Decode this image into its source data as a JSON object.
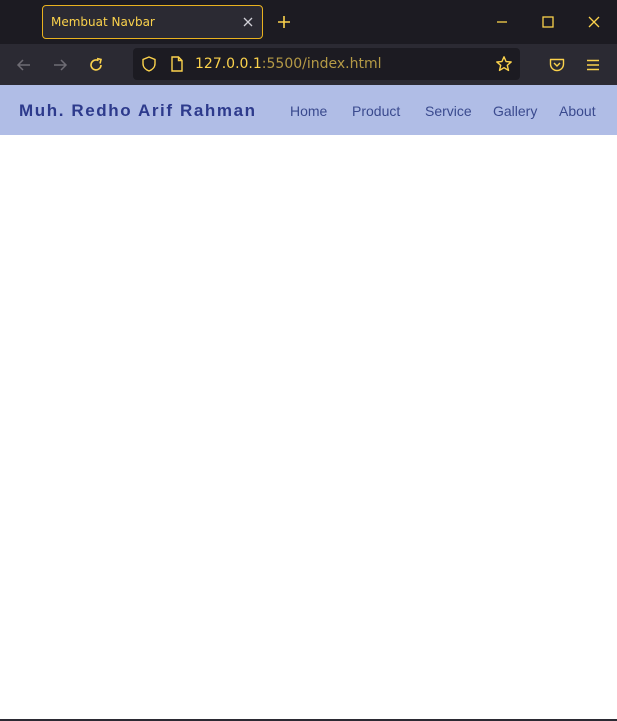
{
  "browser": {
    "tab": {
      "title": "Membuat Navbar"
    },
    "url": {
      "host": "127.0.0.1",
      "path": ":5500/index.html"
    },
    "icons": {
      "back": "back-arrow-icon",
      "forward": "forward-arrow-icon",
      "reload": "reload-icon",
      "shield": "shield-icon",
      "page": "page-icon",
      "bookmark": "star-icon",
      "pocket": "pocket-icon",
      "menu": "hamburger-icon"
    }
  },
  "site": {
    "brand": "Muh. Redho Arif Rahman",
    "nav": {
      "home": "Home",
      "product": "Product",
      "service": "Service",
      "gallery": "Gallery",
      "about": "About"
    }
  },
  "colors": {
    "navbar_bg": "#b0bde6",
    "brand_text": "#2d3a8c",
    "nav_link": "#3a4a8e",
    "browser_accent": "#fbd24c"
  }
}
